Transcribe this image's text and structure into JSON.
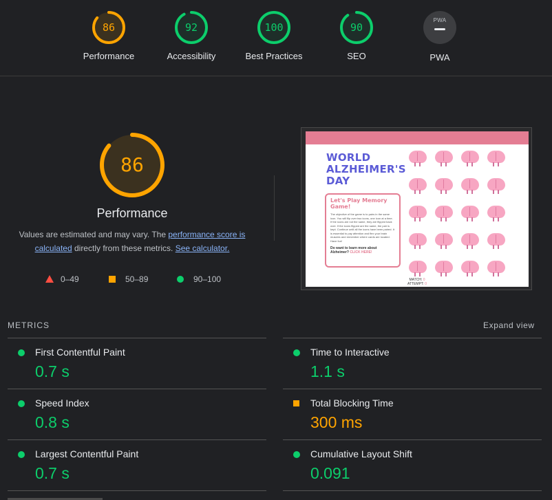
{
  "colors": {
    "pass": "#0cce6b",
    "average": "#ffa400",
    "fail": "#ff4e42",
    "background": "#202124"
  },
  "summary": [
    {
      "label": "Performance",
      "score": "86",
      "value": 0.86,
      "color": "#ffa400"
    },
    {
      "label": "Accessibility",
      "score": "92",
      "value": 0.92,
      "color": "#0cce6b"
    },
    {
      "label": "Best Practices",
      "score": "100",
      "value": 1.0,
      "color": "#0cce6b"
    },
    {
      "label": "SEO",
      "score": "90",
      "value": 0.9,
      "color": "#0cce6b"
    }
  ],
  "pwa": {
    "label": "PWA",
    "badge_text": "PWA"
  },
  "performance": {
    "score": "86",
    "value": 0.86,
    "title": "Performance",
    "desc_prefix": "Values are estimated and may vary. The ",
    "desc_link1": "performance score is calculated",
    "desc_middle": " directly from these metrics. ",
    "desc_link2": "See calculator."
  },
  "legend": {
    "fail": "0–49",
    "average": "50–89",
    "pass": "90–100"
  },
  "screenshot": {
    "headline_lines": [
      "WORLD",
      "ALZHEIMER'S",
      "DAY"
    ],
    "card_title_lines": [
      "Let's Play Memory",
      "Game!"
    ],
    "card_body": "The objective of the game is to pairs in the same icon. You will flip over two icons, one icon at a time. If the icons are not the same, they are flipped back over. If the icons flipped are the same, the pair is kept. Continue until all the icons have been paired. It is essential to pay attention and flex your brain muscles and remember where cards are located. Have fun!",
    "card_question": "Do want to learn more about Alzheimer? ",
    "card_link": "CLICK HERE!",
    "match_label": "MATCH: ",
    "match_value": "0",
    "attempt_label": "ATTEMPT: ",
    "attempt_value": "0"
  },
  "metrics": {
    "header": "METRICS",
    "expand_label": "Expand view",
    "items": [
      {
        "name": "First Contentful Paint",
        "value": "0.7 s",
        "status": "pass"
      },
      {
        "name": "Time to Interactive",
        "value": "1.1 s",
        "status": "pass"
      },
      {
        "name": "Speed Index",
        "value": "0.8 s",
        "status": "pass"
      },
      {
        "name": "Total Blocking Time",
        "value": "300 ms",
        "status": "average"
      },
      {
        "name": "Largest Contentful Paint",
        "value": "0.7 s",
        "status": "pass"
      },
      {
        "name": "Cumulative Layout Shift",
        "value": "0.091",
        "status": "pass"
      }
    ]
  }
}
